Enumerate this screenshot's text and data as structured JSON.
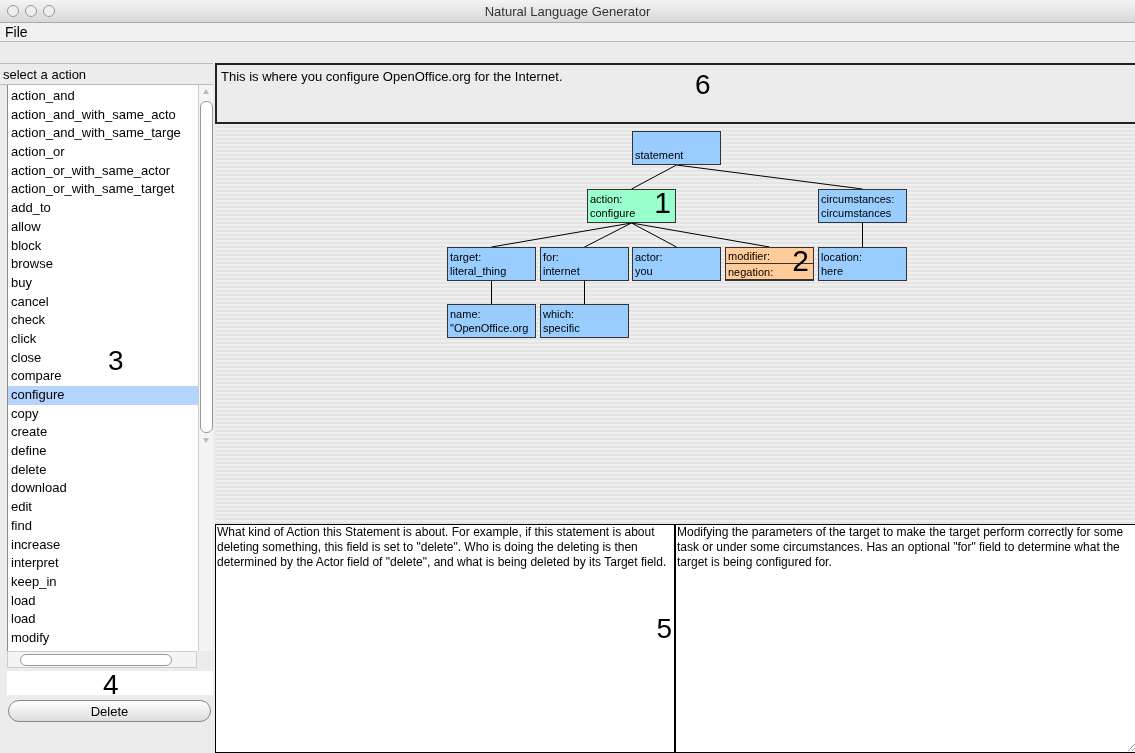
{
  "window": {
    "title": "Natural Language Generator"
  },
  "menu": [
    "File"
  ],
  "action_list": {
    "header": "select a action",
    "callout": "3",
    "items": [
      {
        "label": "action_and",
        "selected": false
      },
      {
        "label": "action_and_with_same_acto",
        "selected": false
      },
      {
        "label": "action_and_with_same_targe",
        "selected": false
      },
      {
        "label": "action_or",
        "selected": false
      },
      {
        "label": "action_or_with_same_actor",
        "selected": false
      },
      {
        "label": "action_or_with_same_target",
        "selected": false
      },
      {
        "label": "add_to",
        "selected": false
      },
      {
        "label": "allow",
        "selected": false
      },
      {
        "label": "block",
        "selected": false
      },
      {
        "label": "browse",
        "selected": false
      },
      {
        "label": "buy",
        "selected": false
      },
      {
        "label": "cancel",
        "selected": false
      },
      {
        "label": "check",
        "selected": false
      },
      {
        "label": "click",
        "selected": false
      },
      {
        "label": "close",
        "selected": false
      },
      {
        "label": "compare",
        "selected": false
      },
      {
        "label": "configure",
        "selected": true
      },
      {
        "label": "copy",
        "selected": false
      },
      {
        "label": "create",
        "selected": false
      },
      {
        "label": "define",
        "selected": false
      },
      {
        "label": "delete",
        "selected": false
      },
      {
        "label": "download",
        "selected": false
      },
      {
        "label": "edit",
        "selected": false
      },
      {
        "label": "find",
        "selected": false
      },
      {
        "label": "increase",
        "selected": false
      },
      {
        "label": "interpret",
        "selected": false
      },
      {
        "label": "keep_in",
        "selected": false
      },
      {
        "label": "load",
        "selected": false
      },
      {
        "label": "load",
        "selected": false
      },
      {
        "label": "modify",
        "selected": false
      }
    ]
  },
  "input": {
    "callout": "4"
  },
  "delete_button": "Delete",
  "sentence": {
    "text": "This is where you configure OpenOffice.org for the Internet.",
    "callout": "6"
  },
  "tree": {
    "kind": "plain",
    "fields": [
      "statement"
    ],
    "color": "#99ccff",
    "children": [
      {
        "kind": "plain",
        "fields": [
          "action:",
          "configure"
        ],
        "color": "#99ffcc",
        "callout": "1",
        "children": [
          {
            "kind": "plain",
            "fields": [
              "target:",
              "literal_thing"
            ],
            "color": "#99ccff",
            "children": [
              {
                "kind": "plain",
                "fields": [
                  "name:",
                  "\"OpenOffice.org"
                ],
                "color": "#99ccff"
              }
            ]
          },
          {
            "kind": "plain",
            "fields": [
              "for:",
              "internet"
            ],
            "color": "#99ccff",
            "children": [
              {
                "kind": "plain",
                "fields": [
                  "which:",
                  "specific"
                ],
                "color": "#99ccff"
              }
            ]
          },
          {
            "kind": "plain",
            "fields": [
              "actor:",
              "you"
            ],
            "color": "#99ccff"
          },
          {
            "kind": "stacked",
            "fields": [
              "modifier:",
              "negation:"
            ],
            "color": "#ffcc99",
            "callout": "2"
          }
        ]
      },
      {
        "kind": "plain",
        "fields": [
          "circumstances:",
          "circumstances"
        ],
        "color": "#99ccff",
        "children": [
          {
            "kind": "plain",
            "fields": [
              "location:",
              "here"
            ],
            "color": "#99ccff"
          }
        ]
      }
    ]
  },
  "descriptions": [
    {
      "text": "What kind of Action this Statement is about. For example, if this statement is about deleting something, this field is set to \"delete\". Who is doing the deleting is then determined by the Actor field of \"delete\", and what is being deleted by its Target field.",
      "callout": "5"
    },
    {
      "text": "Modifying the parameters of the target to make the target perform correctly for some task or under some circumstances. Has an optional \"for\" field to determine what the target is being configured for."
    }
  ]
}
